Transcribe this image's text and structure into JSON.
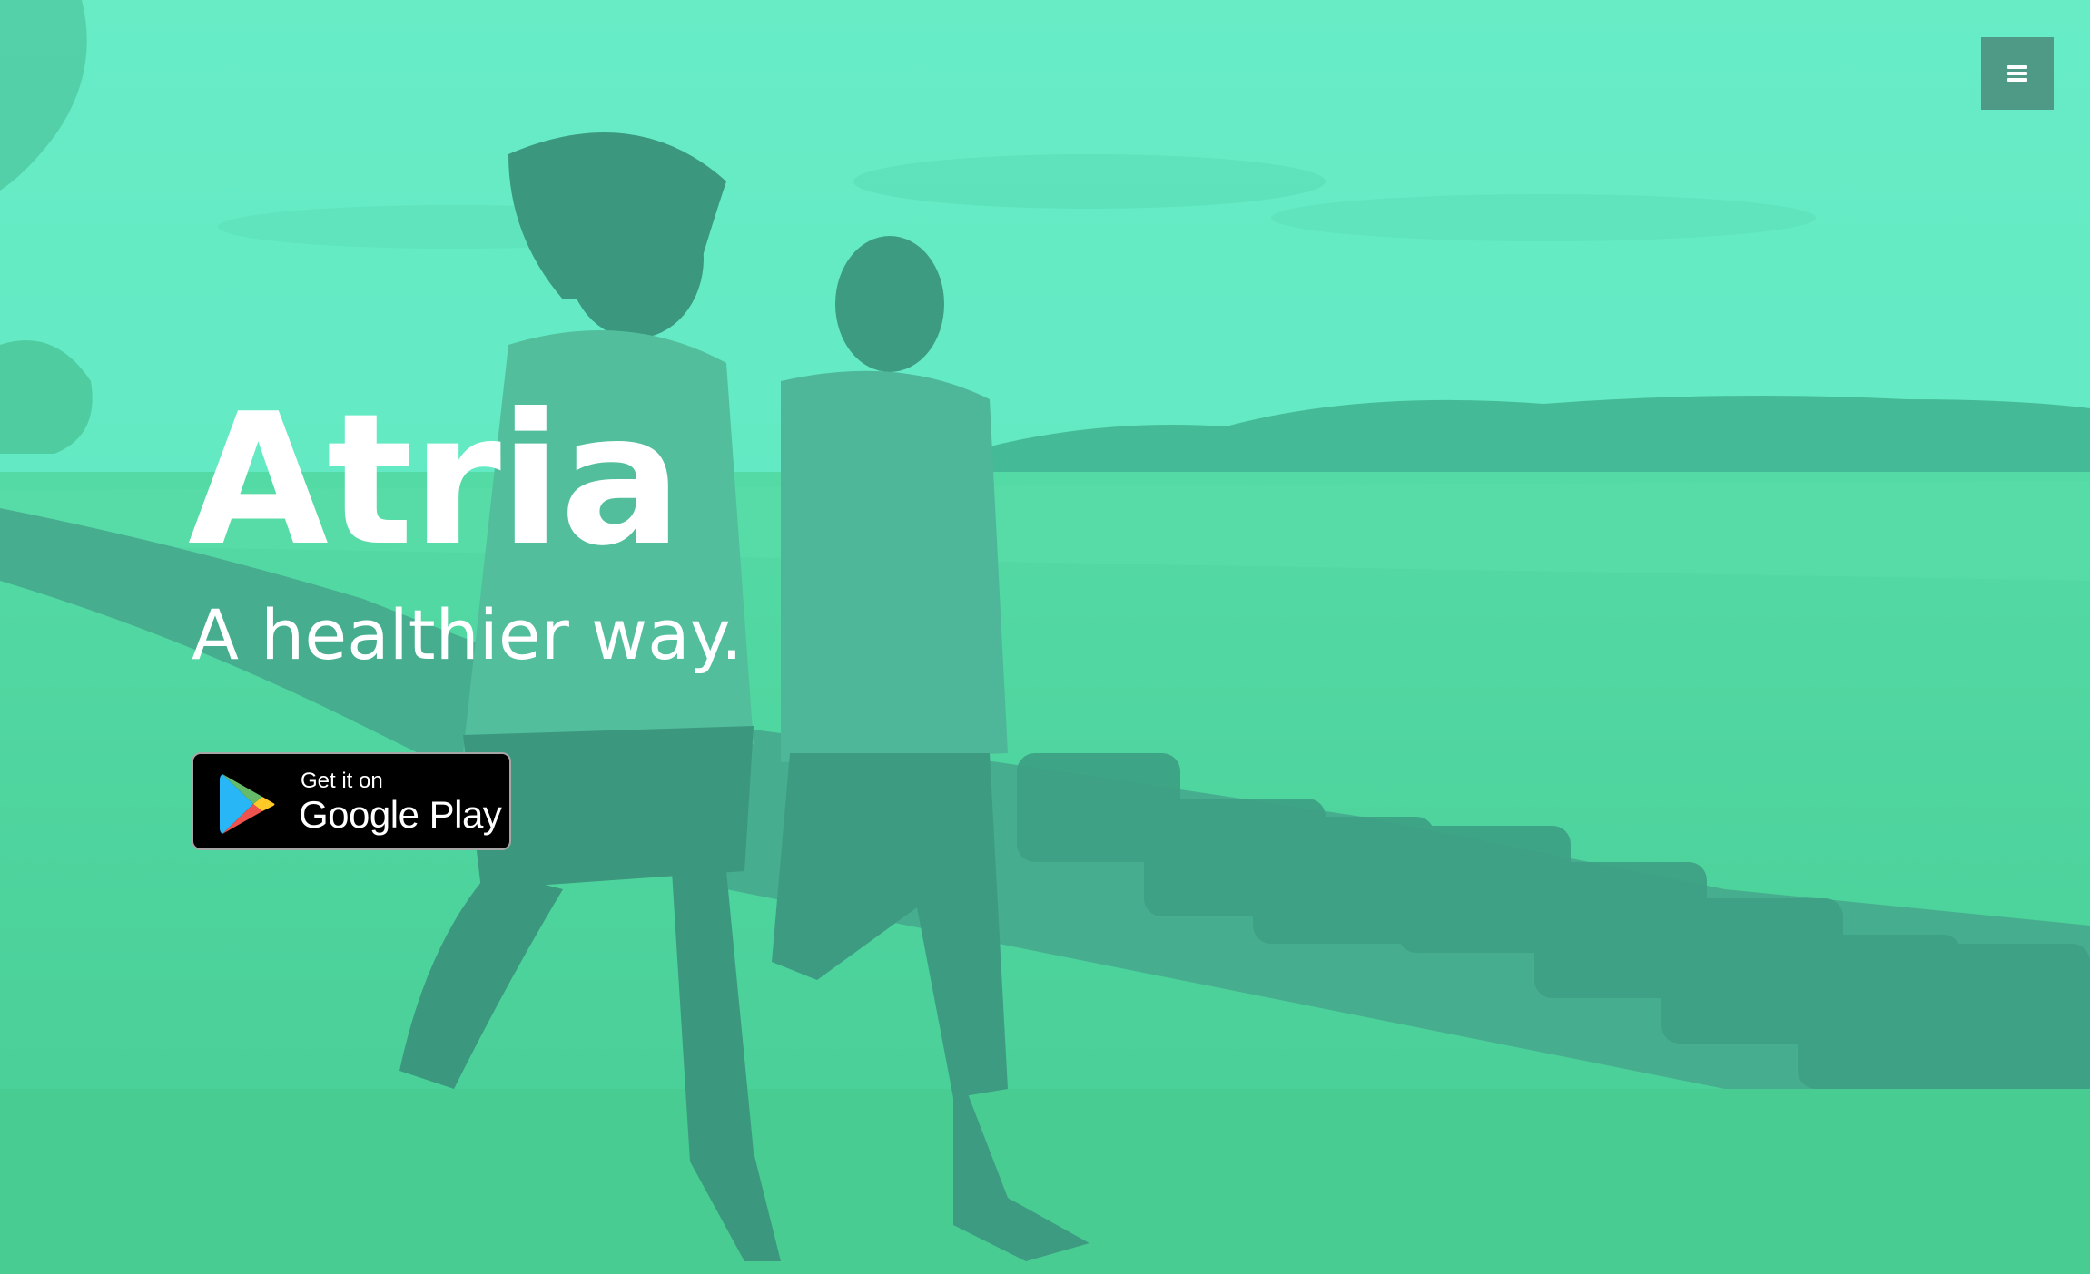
{
  "hero": {
    "title": "Atria",
    "tagline": "A healthier way.",
    "background_tint": "#5fe3b8"
  },
  "nav": {
    "menu_icon": "hamburger-menu-icon",
    "menu_color": "#4e9a86"
  },
  "store_badge": {
    "small_text": "Get it on",
    "large_text": "Google Play",
    "icon": "google-play-icon"
  }
}
